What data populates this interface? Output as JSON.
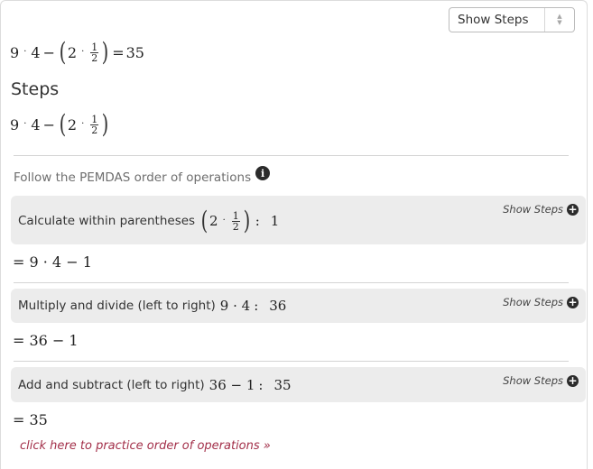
{
  "toolbar": {
    "mode_select": {
      "value": "Show Steps"
    }
  },
  "problem": {
    "equation": {
      "a": "9",
      "b": "4",
      "c": "2",
      "frac_num": "1",
      "frac_den": "2",
      "result": "35"
    }
  },
  "steps": {
    "title": "Steps",
    "expression": {
      "a": "9",
      "b": "4",
      "c": "2",
      "frac_num": "1",
      "frac_den": "2"
    },
    "instruction": "Follow the PEMDAS order of operations",
    "items": [
      {
        "label": "Calculate within parentheses",
        "expr_c": "2",
        "expr_frac_num": "1",
        "expr_frac_den": "2",
        "value": "1",
        "show_steps": "Show Steps",
        "result": "= 9 · 4 − 1"
      },
      {
        "label": "Multiply and divide (left to right)",
        "expr": "9 · 4",
        "value": "36",
        "show_steps": "Show Steps",
        "result": "= 36 − 1"
      },
      {
        "label": "Add and subtract (left to right)",
        "expr": "36 − 1",
        "value": "35",
        "show_steps": "Show Steps",
        "result": "= 35"
      }
    ]
  },
  "practice_link": "click here to practice order of operations »"
}
